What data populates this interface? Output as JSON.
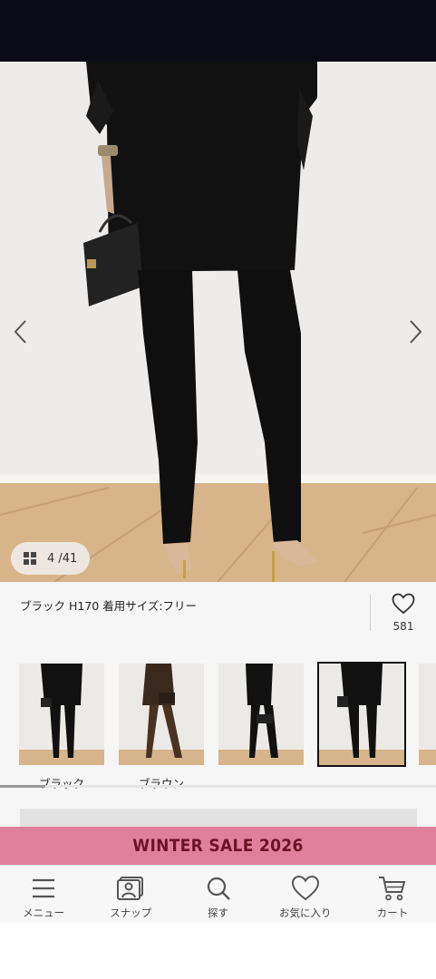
{
  "product": {
    "image_counter": "4 /41",
    "caption": "ブラック H170 着用サイズ:フリー",
    "favorite_count": "581"
  },
  "variants": [
    {
      "label": "ブラック",
      "selected": false
    },
    {
      "label": "ブラウン",
      "selected": false
    },
    {
      "label": "",
      "selected": false
    },
    {
      "label": "",
      "selected": true
    }
  ],
  "sale_banner": {
    "text": "WINTER SALE 2026",
    "bg_color": "#e07f9b",
    "text_color": "#6a1327"
  },
  "bottom_nav": {
    "menu": "メニュー",
    "snap": "スナップ",
    "search": "探す",
    "favorites": "お気に入り",
    "cart": "カート"
  },
  "icons": [
    "grid-icon",
    "chevron-left-icon",
    "chevron-right-icon",
    "heart-icon",
    "menu-icon",
    "snap-icon",
    "search-icon",
    "favorites-icon",
    "cart-icon"
  ]
}
